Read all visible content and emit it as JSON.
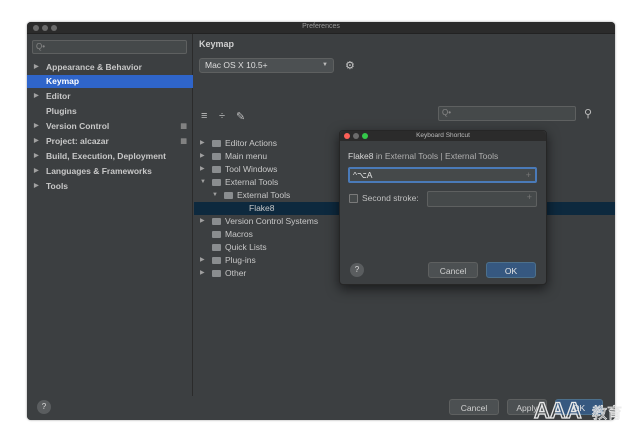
{
  "window": {
    "title": "Preferences"
  },
  "sidebar": {
    "search_placeholder": "Q•",
    "items": [
      {
        "label": "Appearance & Behavior",
        "arrow": "▶"
      },
      {
        "label": "Keymap",
        "arrow": ""
      },
      {
        "label": "Editor",
        "arrow": "▶"
      },
      {
        "label": "Plugins",
        "arrow": ""
      },
      {
        "label": "Version Control",
        "arrow": "▶"
      },
      {
        "label": "Project: alcazar",
        "arrow": "▶"
      },
      {
        "label": "Build, Execution, Deployment",
        "arrow": "▶"
      },
      {
        "label": "Languages & Frameworks",
        "arrow": "▶"
      },
      {
        "label": "Tools",
        "arrow": "▶"
      }
    ]
  },
  "content": {
    "heading": "Keymap",
    "keymap_value": "Mac OS X 10.5+",
    "filter_placeholder": "Q•"
  },
  "tree": [
    {
      "label": "Editor Actions",
      "arrow": "▶"
    },
    {
      "label": "Main menu",
      "arrow": "▶"
    },
    {
      "label": "Tool Windows",
      "arrow": "▶"
    },
    {
      "label": "External Tools",
      "arrow": "▼"
    },
    {
      "label": "External Tools",
      "arrow": "▼"
    },
    {
      "label": "Flake8",
      "arrow": ""
    },
    {
      "label": "Version Control Systems",
      "arrow": "▶"
    },
    {
      "label": "Macros",
      "arrow": ""
    },
    {
      "label": "Quick Lists",
      "arrow": ""
    },
    {
      "label": "Plug-ins",
      "arrow": "▶"
    },
    {
      "label": "Other",
      "arrow": "▶"
    }
  ],
  "footer": {
    "help": "?",
    "cancel": "Cancel",
    "apply": "Apply",
    "ok": "OK"
  },
  "dialog": {
    "title": "Keyboard Shortcut",
    "action": "Flake8",
    "path_rest": "in External Tools | External Tools",
    "first_stroke": "^⌥A",
    "second_stroke_label": "Second stroke:",
    "help": "?",
    "cancel": "Cancel",
    "ok": "OK"
  },
  "colors": {
    "selection": "#2f65ca",
    "primary_button": "#365880",
    "focus_border": "#4a7ab8",
    "background": "#3c3f41"
  },
  "watermark": {
    "text": "AAA教育"
  }
}
